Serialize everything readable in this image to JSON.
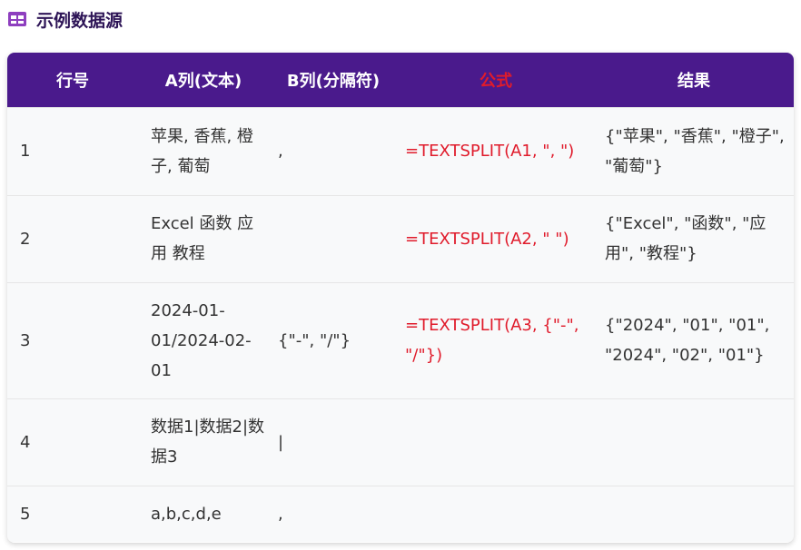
{
  "header": {
    "title": "示例数据源",
    "icon": "table-icon"
  },
  "colors": {
    "header_bg": "#4a1a8c",
    "formula_red": "#e01b2b",
    "title_color": "#2d1456",
    "row_bg": "#f8f9fa"
  },
  "table": {
    "columns": [
      "行号",
      "A列(文本)",
      "B列(分隔符)",
      "公式",
      "结果"
    ],
    "rows": [
      {
        "row": "1",
        "text": "苹果, 香蕉, 橙子, 葡萄",
        "delimiter": ",",
        "formula": "=TEXTSPLIT(A1, \", \")",
        "result": "{\"苹果\", \"香蕉\", \"橙子\", \"葡萄\"}"
      },
      {
        "row": "2",
        "text": "Excel 函数 应用 教程",
        "delimiter": "",
        "formula": "=TEXTSPLIT(A2, \" \")",
        "result": "{\"Excel\", \"函数\", \"应用\", \"教程\"}"
      },
      {
        "row": "3",
        "text": "2024-01-01/2024-02-01",
        "delimiter": "{\"-\", \"/\"}",
        "formula": "=TEXTSPLIT(A3, {\"-\", \"/\"})",
        "result": "{\"2024\", \"01\", \"01\", \"2024\", \"02\", \"01\"}"
      },
      {
        "row": "4",
        "text": "数据1|数据2|数据3",
        "delimiter": "|",
        "formula": "",
        "result": ""
      },
      {
        "row": "5",
        "text": "a,b,c,d,e",
        "delimiter": ",",
        "formula": "",
        "result": ""
      }
    ]
  }
}
